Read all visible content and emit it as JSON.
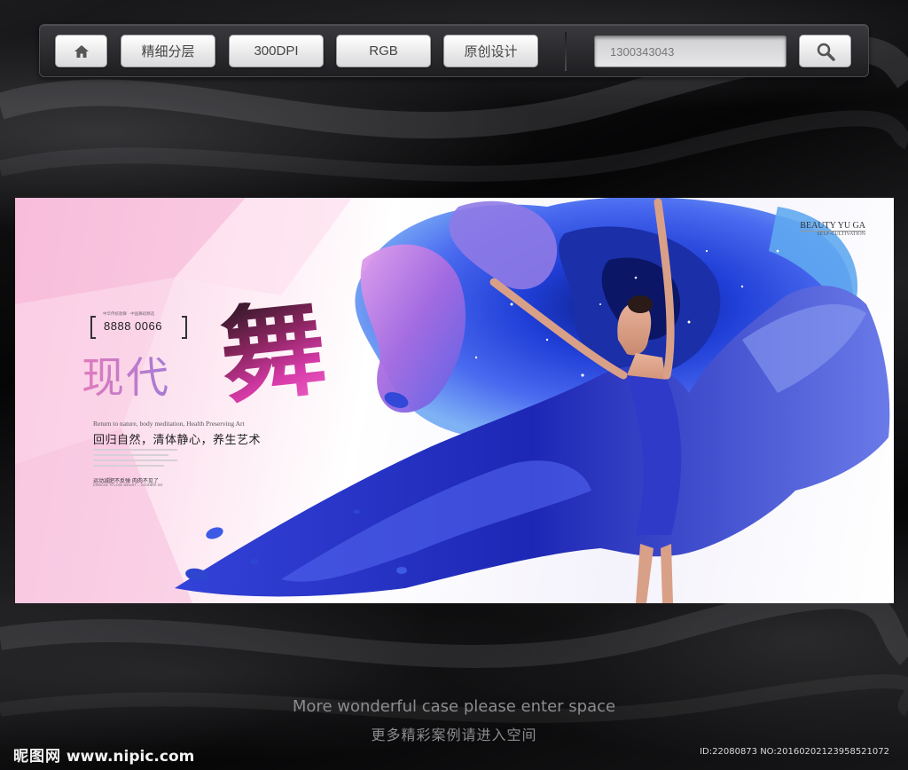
{
  "toolbar": {
    "home_icon": "home-icon",
    "buttons": [
      "精细分层",
      "300DPI",
      "RGB",
      "原创设计"
    ],
    "search_value": "1300343043",
    "search_icon": "magnifier-icon"
  },
  "banner": {
    "tel_small": "中华传统歌舞 · 中国舞蹈精选",
    "tel": "8888 0066",
    "title_1": "现代",
    "title_2": "舞",
    "english_line": "Return to nature, body meditation, Health Preserving Art",
    "chinese_line": "回归自然，清体静心，养生艺术",
    "slogan_cn": "运动减肥不反弹  肉肉不见了",
    "slogan_en": "EXERCISE TO LOSE WEIGHT ... GOODBYE FAT",
    "brand_1": "BEAUTY YU GA",
    "brand_2": "SELF-CULTIVATION",
    "colors": {
      "rose": "#3a5be0",
      "dress": "#2b3bd0",
      "petal": "#b06be0",
      "pink": "#f7c6e0"
    }
  },
  "footer": {
    "english": "More wonderful case please enter space",
    "chinese": "更多精彩案例请进入空间",
    "logo_cn": "昵图网",
    "logo_url": "www.nipic.com",
    "id_line": "ID:22080873 NO:20160202123958521072"
  }
}
